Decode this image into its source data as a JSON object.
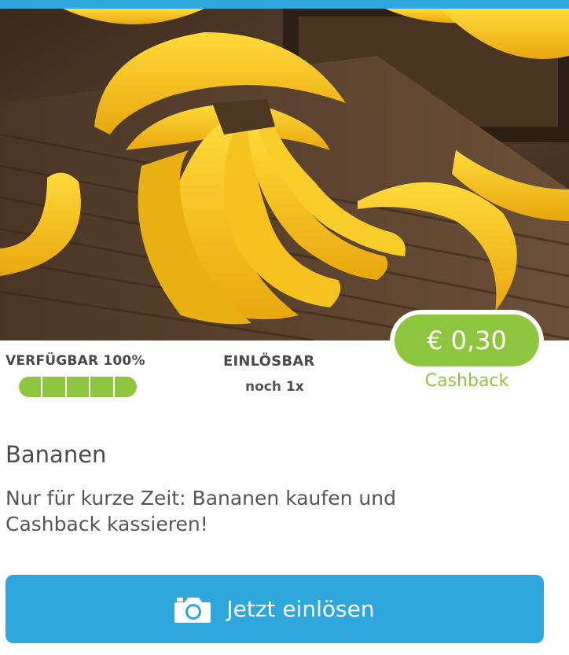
{
  "product": {
    "image_alt": "Bananen",
    "name": "Bananen",
    "description": "Nur für kurze Zeit: Bananen kaufen und Cashback kassieren!"
  },
  "availability": {
    "label": "VERFÜGBAR",
    "percent_text": "100%",
    "percent_value": 100,
    "segments": 5
  },
  "redeemable": {
    "label": "EINLÖSBAR",
    "prefix": "noch",
    "count": "1x"
  },
  "cashback": {
    "amount": "€ 0,30",
    "label": "Cashback"
  },
  "cta": {
    "label": "Jetzt einlösen",
    "icon": "camera-icon"
  },
  "colors": {
    "brand_blue": "#2fa6dc",
    "accent_green": "#8fc63f"
  }
}
